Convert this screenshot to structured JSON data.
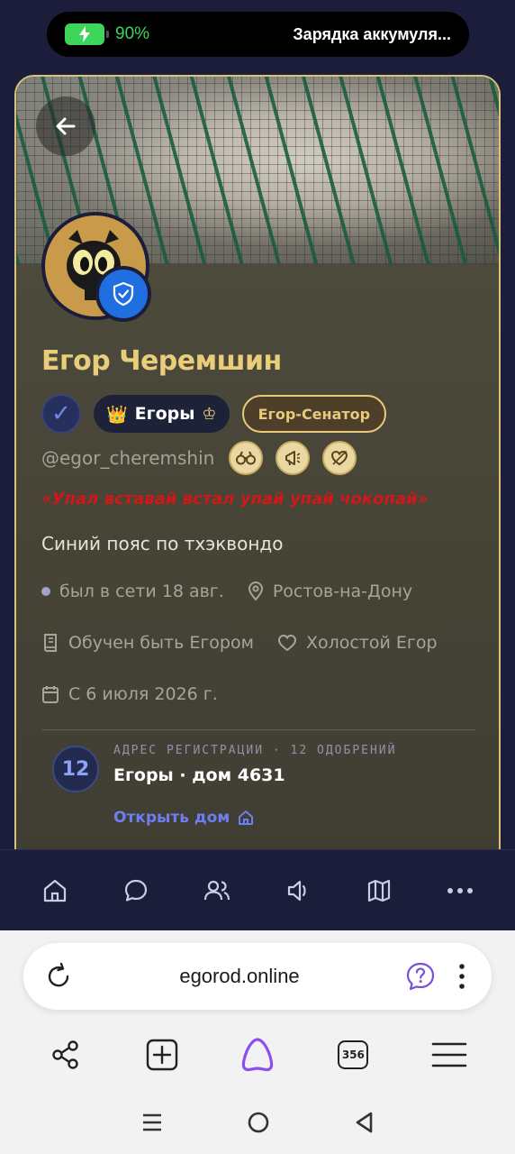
{
  "status": {
    "battery_pct": "90%",
    "notification": "Зарядка аккумуля..."
  },
  "profile": {
    "name": "Егор Черемшин",
    "group_badge": "Егоры",
    "title_badge": "Егор-Сенатор",
    "handle": "@egor_cheremshin",
    "quote": "«Упал вставай встал упай упай чокопай»",
    "bio": "Синий пояс по тхэквондо",
    "last_seen": "был в сети 18 авг.",
    "location": "Ростов-на-Дону",
    "education": "Обучен быть Егором",
    "relationship": "Холостой Егор",
    "joined": "С 6 июля 2026 г.",
    "achievement_icons": [
      "binoculars-icon",
      "megaphone-icon",
      "cupid-heart-icon"
    ]
  },
  "registration": {
    "count": "12",
    "label": "АДРЕС РЕГИСТРАЦИИ · 12 ОДОБРЕНИЙ",
    "title": "Егоры · дом 4631",
    "link": "Открыть дом"
  },
  "app_nav": [
    "home-icon",
    "chat-icon",
    "people-icon",
    "speaker-icon",
    "map-icon",
    "more-icon"
  ],
  "browser": {
    "url": "egorod.online",
    "tabs_count": "356"
  },
  "colors": {
    "accent_gold": "#e9cd7a",
    "link_blue": "#6d7ff0",
    "quote_red": "#d31616",
    "page_bg": "#1b1d3a"
  }
}
